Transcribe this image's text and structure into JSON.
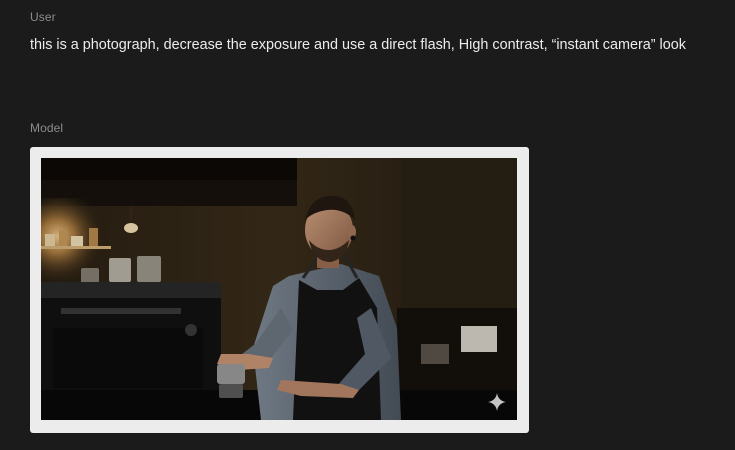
{
  "conversation": {
    "user": {
      "role_label": "User",
      "message": "this is a photograph, decrease the exposure and use a direct flash, High contrast, “instant camera” look"
    },
    "model": {
      "role_label": "Model"
    }
  },
  "colors": {
    "background": "#1b1b1b",
    "role_label": "#8c8c8c",
    "message_text": "#ececec",
    "image_frame": "#ececec"
  },
  "icons": {
    "generated_mark": "sparkle-icon"
  }
}
